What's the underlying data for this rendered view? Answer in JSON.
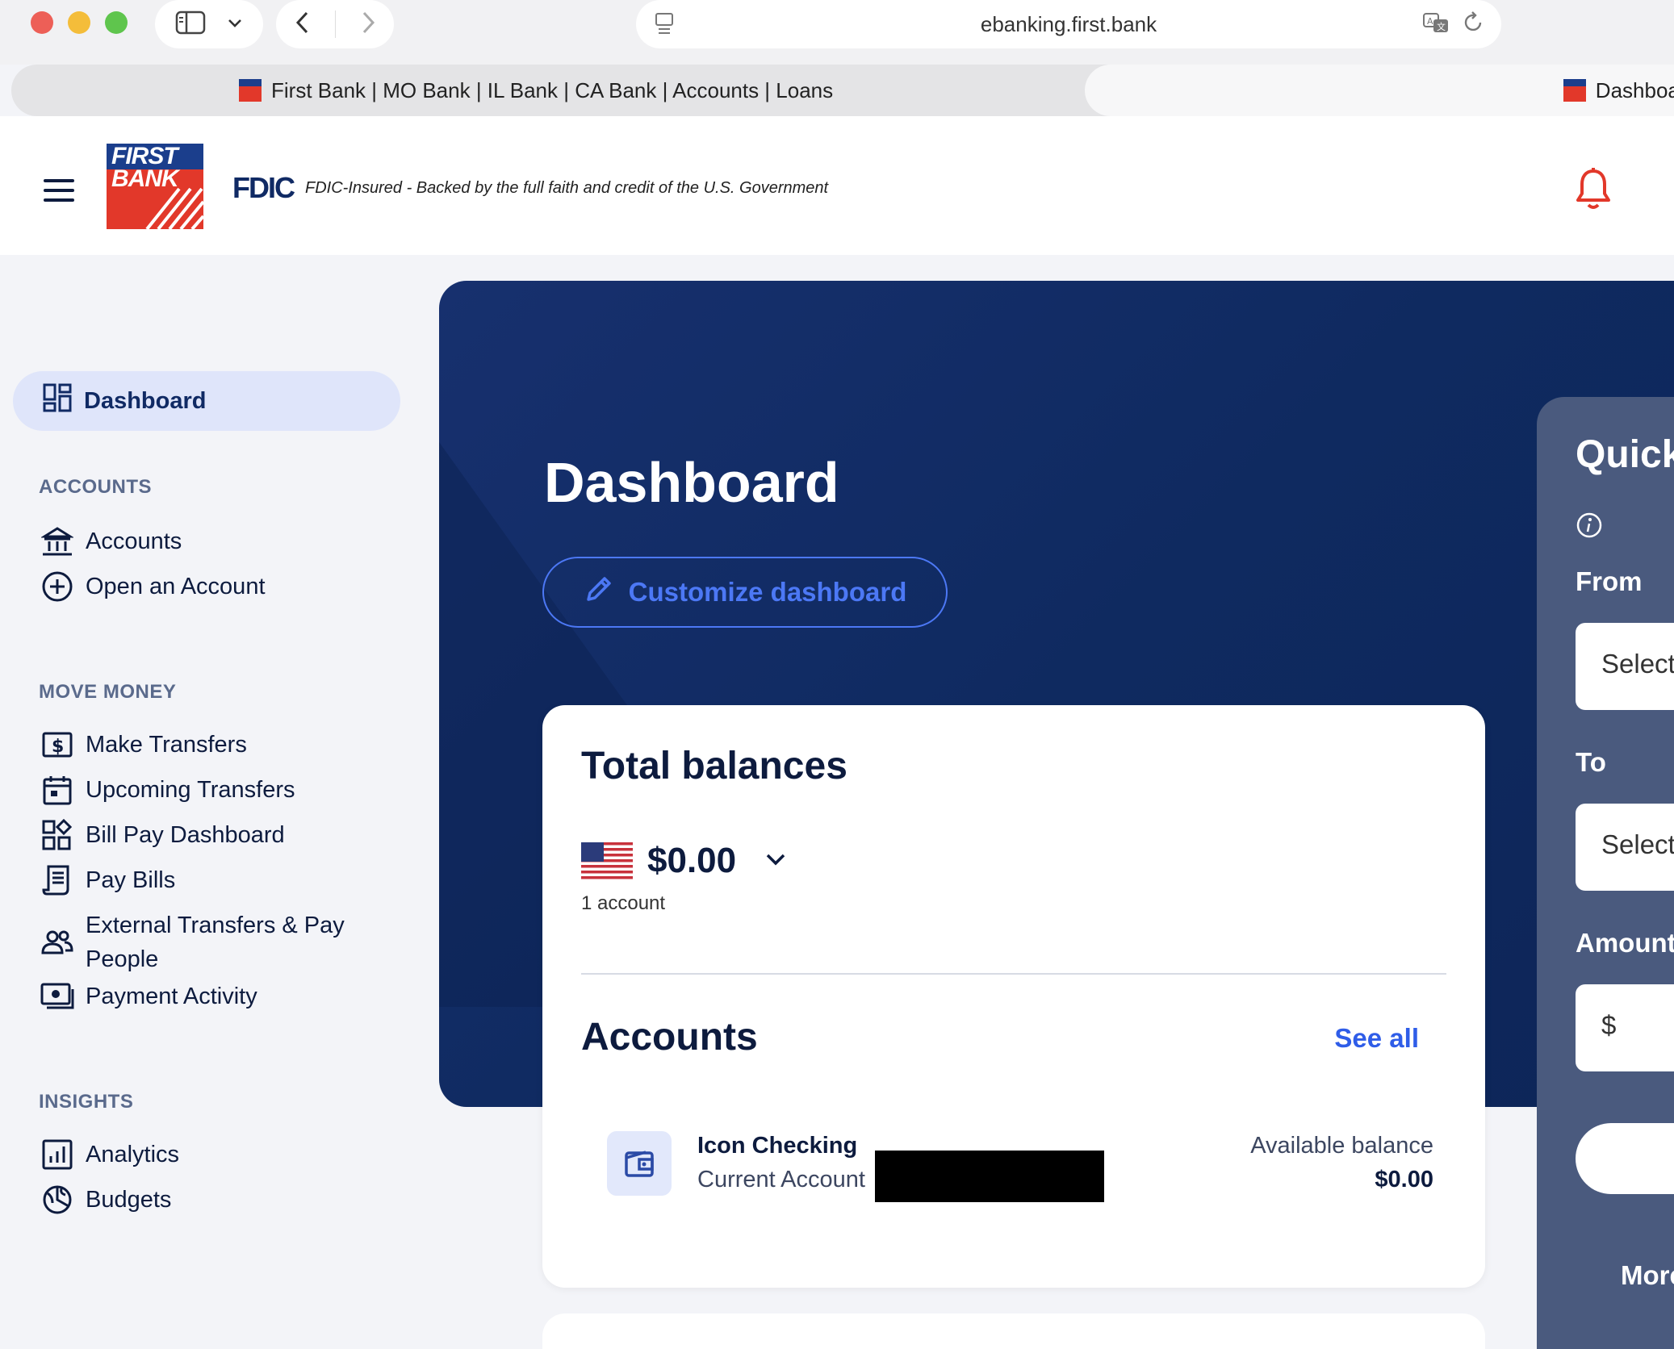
{
  "browser": {
    "url": "ebanking.first.bank",
    "tabs": [
      {
        "label": "First Bank | MO Bank | IL Bank | CA Bank | Accounts | Loans"
      },
      {
        "label": "Dashboard"
      }
    ]
  },
  "header": {
    "logo_text": "FIRST BANK",
    "fdic_mark": "FDIC",
    "fdic_text": "FDIC-Insured - Backed by the full faith and credit of the U.S. Government"
  },
  "sidebar": {
    "active": {
      "label": "Dashboard",
      "icon": "dashboard-icon"
    },
    "sections": [
      {
        "title": "ACCOUNTS",
        "items": [
          {
            "label": "Accounts",
            "icon": "bank-icon"
          },
          {
            "label": "Open an Account",
            "icon": "plus-circle-icon"
          }
        ]
      },
      {
        "title": "MOVE MONEY",
        "items": [
          {
            "label": "Make Transfers",
            "icon": "dollar-square-icon"
          },
          {
            "label": "Upcoming Transfers",
            "icon": "calendar-icon"
          },
          {
            "label": "Bill Pay Dashboard",
            "icon": "bill-dashboard-icon"
          },
          {
            "label": "Pay Bills",
            "icon": "receipt-icon"
          },
          {
            "label": "External Transfers & Pay People",
            "icon": "people-icon"
          },
          {
            "label": "Payment Activity",
            "icon": "money-icon"
          }
        ]
      },
      {
        "title": "INSIGHTS",
        "items": [
          {
            "label": "Analytics",
            "icon": "analytics-icon"
          },
          {
            "label": "Budgets",
            "icon": "budget-icon"
          }
        ]
      }
    ]
  },
  "main": {
    "title": "Dashboard",
    "customize_label": "Customize dashboard",
    "total_balances": {
      "title": "Total balances",
      "amount": "$0.00",
      "account_count": "1 account"
    },
    "accounts": {
      "title": "Accounts",
      "see_all": "See all",
      "items": [
        {
          "name": "Icon Checking",
          "type": "Current Account",
          "balance_label": "Available balance",
          "balance": "$0.00"
        }
      ]
    }
  },
  "quick_transfer": {
    "title": "Quick",
    "from_label": "From",
    "from_placeholder": "Select",
    "to_label": "To",
    "to_placeholder": "Select",
    "amount_label": "Amount",
    "amount_prefix": "$",
    "more_label": "More"
  },
  "colors": {
    "brand_navy": "#102a64",
    "hero_bg": "#0f2a60",
    "accent_blue": "#2f5de8",
    "bank_red": "#e2382a",
    "active_nav_bg": "#dfe5fa"
  }
}
